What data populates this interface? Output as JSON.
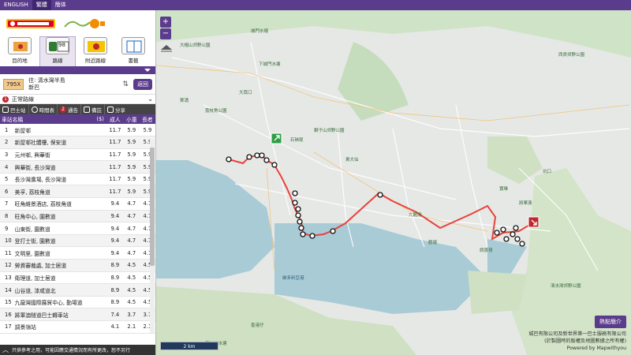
{
  "topbar": {
    "languages": [
      "ENGLISH",
      "繁體",
      "簡体"
    ],
    "active": 1
  },
  "nav": {
    "items": [
      {
        "label": "目的地",
        "icon": "destination-icon"
      },
      {
        "label": "路線",
        "icon": "route-icon",
        "badge": "98"
      },
      {
        "label": "附近路線",
        "icon": "nearby-icon"
      },
      {
        "label": "書籤",
        "icon": "bookmark-icon"
      }
    ],
    "active": 1
  },
  "route": {
    "number": "795X",
    "destination_line1": "往: 清水灣半島",
    "destination_line2": "新巴",
    "swap_symbol": "⇅",
    "back_label": "返回"
  },
  "reason": {
    "marker": "1",
    "label": "正常路線"
  },
  "tools": [
    {
      "label": "巴士站",
      "icon": "bus-stop-icon"
    },
    {
      "label": "時間表",
      "icon": "clock-icon"
    },
    {
      "label": "通告",
      "icon": "notice-icon",
      "marker": "2"
    },
    {
      "label": "備註",
      "icon": "remarks-icon"
    },
    {
      "label": "分享",
      "icon": "share-icon"
    }
  ],
  "table": {
    "headers": [
      "車站名稱",
      "($)",
      "成人",
      "小童",
      "長者"
    ],
    "rows": [
      [
        "1",
        "新屋邨",
        "11.7",
        "5.9",
        "5.9"
      ],
      [
        "2",
        "新屋邨社體樓, 保安道",
        "11.7",
        "5.9",
        "5.9"
      ],
      [
        "3",
        "元州邨, 興華街",
        "11.7",
        "5.9",
        "5.9"
      ],
      [
        "4",
        "興華街, 長沙灣道",
        "11.7",
        "5.9",
        "5.9"
      ],
      [
        "5",
        "長沙灣廣場, 長沙灣道",
        "11.7",
        "5.9",
        "5.9"
      ],
      [
        "6",
        "美孚, 荔枝角道",
        "11.7",
        "5.9",
        "5.9"
      ],
      [
        "7",
        "旺角維景酒店, 荔枝角道",
        "9.4",
        "4.7",
        "4.7"
      ],
      [
        "8",
        "旺角中心, 園數道",
        "9.4",
        "4.7",
        "4.7"
      ],
      [
        "9",
        "山東街, 園數道",
        "9.4",
        "4.7",
        "4.7"
      ],
      [
        "10",
        "登打士街, 園數道",
        "9.4",
        "4.7",
        "4.7"
      ],
      [
        "11",
        "文明里, 園數道",
        "9.4",
        "4.7",
        "4.7"
      ],
      [
        "12",
        "勞資審裁處, 加士居道",
        "8.9",
        "4.5",
        "4.5"
      ],
      [
        "13",
        "衛理道, 加士居道",
        "8.9",
        "4.5",
        "4.5"
      ],
      [
        "14",
        "山谷道, 漆咸道北",
        "8.9",
        "4.5",
        "4.5"
      ],
      [
        "15",
        "九龍灣國際展貿中心, 勤場道",
        "8.9",
        "4.5",
        "4.5"
      ],
      [
        "16",
        "將軍澳隧道巴士轉車站",
        "7.4",
        "3.7",
        "3.7"
      ],
      [
        "17",
        "調景嶺站",
        "4.1",
        "2.1",
        "2.1"
      ]
    ]
  },
  "bottom_notice": "只供參考之用，可能因應交通情況而有所更改，恕不另行",
  "map": {
    "zoom_in": "+",
    "zoom_out": "−",
    "scale": "2 km",
    "intro_button": "熱點簡介",
    "copyright": [
      "城巴有限公司及新世界第一巴士服務有限公司",
      "(於製圖時的版權及地圖數據之所有權)",
      "Powered by Mapwithyou"
    ],
    "labels": [
      "城門水塘",
      "下城門水塘",
      "葵涌",
      "荔枝角公園",
      "大窩口",
      "石硤尾",
      "黃大仙",
      "九龍灣",
      "觀塘",
      "將軍澳",
      "寶琳",
      "坑口",
      "調景嶺",
      "維多利亞港",
      "香港仔",
      "西貢郊野公園",
      "清水灣郊野公園",
      "大帽山郊野公園",
      "獅子山郊野公園",
      "薄扶林水塘"
    ],
    "route_color": "#e8423a",
    "start_color": "#2e9e44",
    "end_color": "#c0262d"
  }
}
